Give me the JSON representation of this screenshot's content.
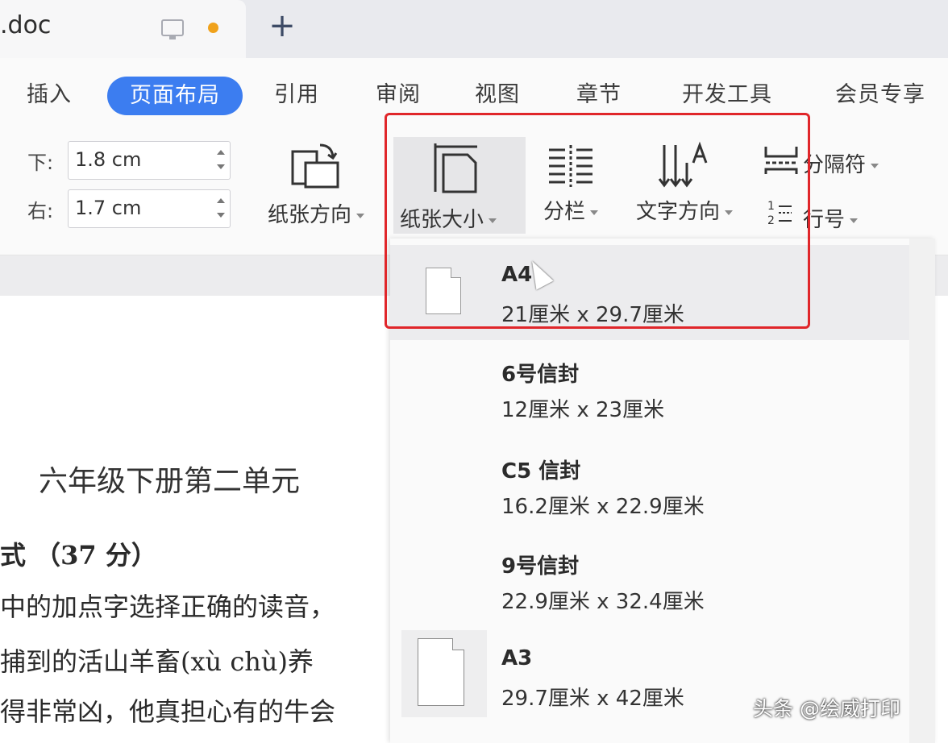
{
  "tab": {
    "title": ".doc",
    "new_tab": "+"
  },
  "menu": [
    "插入",
    "页面布局",
    "引用",
    "审阅",
    "视图",
    "章节",
    "开发工具",
    "会员专享"
  ],
  "margins": {
    "bottom_label": "下:",
    "bottom_value": "1.8 cm",
    "right_label": "右:",
    "right_value": "1.7 cm"
  },
  "tools": {
    "orientation": "纸张方向",
    "paper_size": "纸张大小",
    "columns": "分栏",
    "text_direction": "文字方向",
    "separator": "分隔符",
    "line_number": "行号"
  },
  "paper_options": [
    {
      "name": "A4",
      "dims": "21厘米  x  29.7厘米"
    },
    {
      "name": "6号信封",
      "dims": "12厘米  x  23厘米"
    },
    {
      "name": "C5 信封",
      "dims": "16.2厘米  x  22.9厘米"
    },
    {
      "name": "9号信封",
      "dims": "22.9厘米  x  32.4厘米"
    },
    {
      "name": "A3",
      "dims": "29.7厘米  x  42厘米"
    }
  ],
  "document": {
    "title": "六年级下册第二单元",
    "line1": "式  （37 分）",
    "line2": "中的加点字选择正确的读音，",
    "line3": "捕到的活山羊畜(xù    chù)养",
    "line4": "得非常凶，他真担心有的牛会"
  },
  "watermark": "头条 @绘威打印"
}
